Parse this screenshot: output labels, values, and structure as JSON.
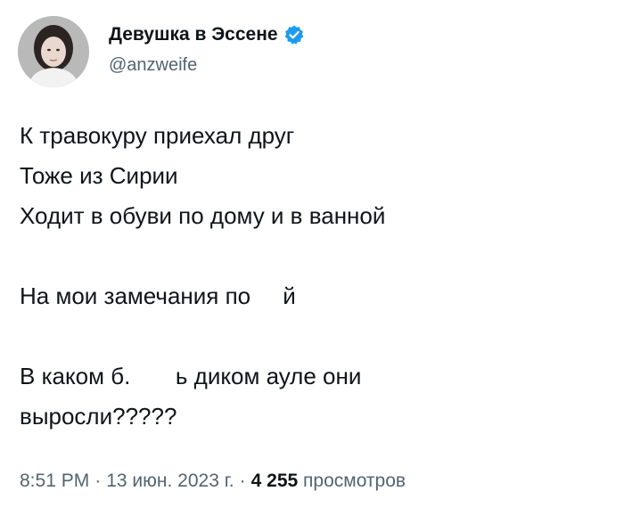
{
  "author": {
    "display_name": "Девушка в Эссене",
    "handle": "@anzweife",
    "verified": true,
    "verified_color": "#1d9bf0"
  },
  "tweet": {
    "lines": [
      "К травокуру приехал друг",
      "Тоже из Сирии",
      "Ходит в обуви по дому и в ванной",
      "",
      "На мои замечания по     й",
      "",
      "В каком б.       ь диком ауле они",
      "выросли?????"
    ]
  },
  "meta": {
    "time": "8:51 PM",
    "separator": "·",
    "date": "13 июн. 2023 г.",
    "views_count": "4 255",
    "views_label": "просмотров"
  }
}
